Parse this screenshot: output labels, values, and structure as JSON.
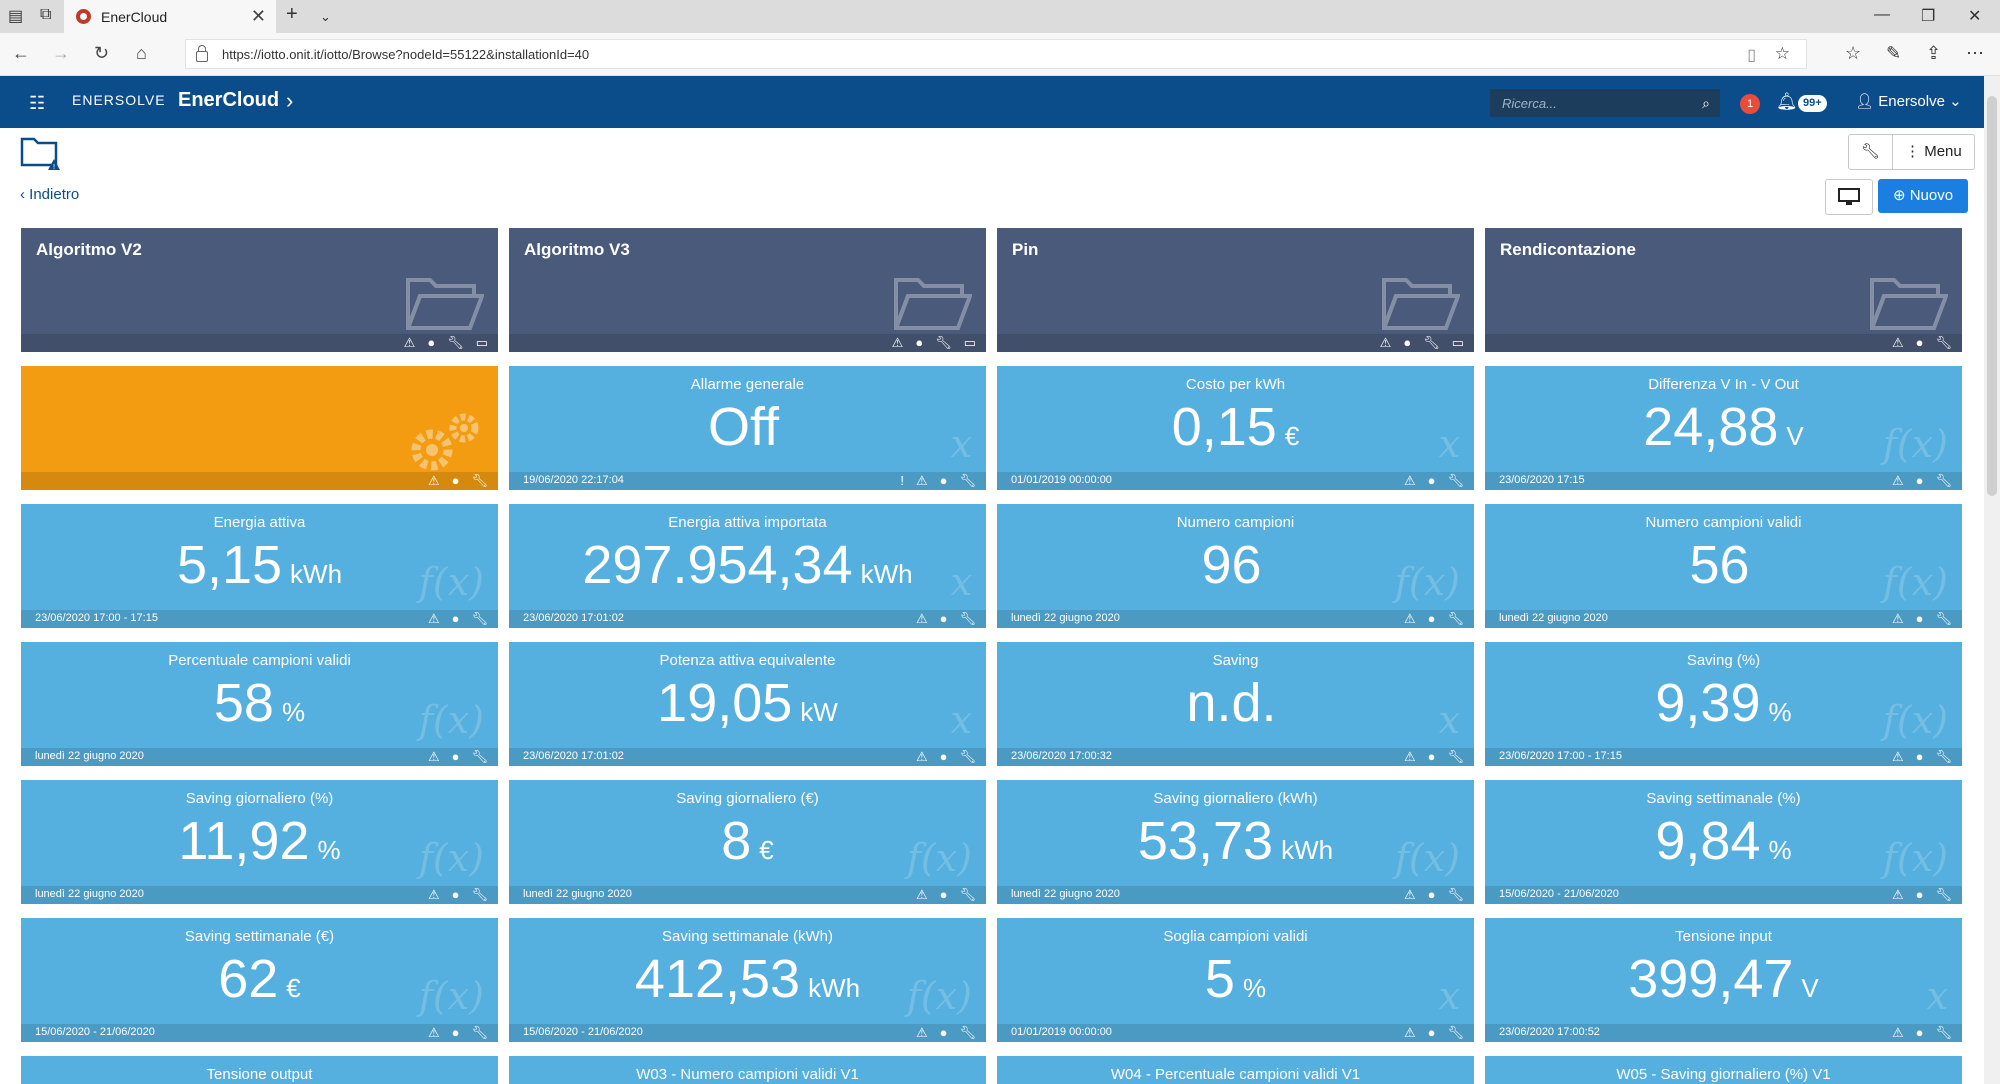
{
  "browser": {
    "tab_title": "EnerCloud",
    "url": "https://iotto.onit.it/iotto/Browse?nodeId=55122&installationId=40"
  },
  "header": {
    "logo": "ENERSOLVE",
    "brand": "EnerCloud",
    "search_placeholder": "Ricerca...",
    "alert_count": "1",
    "notif_count": "99+",
    "user": "Enersolve"
  },
  "sub": {
    "back_label": "Indietro",
    "menu_label": "Menu",
    "new_label": "Nuovo"
  },
  "folders": [
    {
      "title": "Algoritmo V2"
    },
    {
      "title": "Algoritmo V3"
    },
    {
      "title": "Pin"
    },
    {
      "title": "Rendicontazione"
    }
  ],
  "tiles": [
    {
      "title": "Allarme generale",
      "value": "Off",
      "unit": "",
      "date": "19/06/2020 22:17:04",
      "fx": "x"
    },
    {
      "title": "Costo per kWh",
      "value": "0,15",
      "unit": "€",
      "date": "01/01/2019 00:00:00",
      "fx": "x"
    },
    {
      "title": "Differenza V In - V Out",
      "value": "24,88",
      "unit": "V",
      "date": "23/06/2020 17:15",
      "fx": "f(x)"
    },
    {
      "title": "Energia attiva",
      "value": "5,15",
      "unit": "kWh",
      "date": "23/06/2020 17:00 - 17:15",
      "fx": "f(x)"
    },
    {
      "title": "Energia attiva importata",
      "value": "297.954,34",
      "unit": "kWh",
      "date": "23/06/2020 17:01:02",
      "fx": "x"
    },
    {
      "title": "Numero campioni",
      "value": "96",
      "unit": "",
      "date": "lunedì 22 giugno 2020",
      "fx": "f(x)"
    },
    {
      "title": "Numero campioni validi",
      "value": "56",
      "unit": "",
      "date": "lunedì 22 giugno 2020",
      "fx": "f(x)"
    },
    {
      "title": "Percentuale campioni validi",
      "value": "58",
      "unit": "%",
      "date": "lunedì 22 giugno 2020",
      "fx": "f(x)"
    },
    {
      "title": "Potenza attiva equivalente",
      "value": "19,05",
      "unit": "kW",
      "date": "23/06/2020 17:01:02",
      "fx": "x"
    },
    {
      "title": "Saving",
      "value": "n.d.",
      "unit": "",
      "date": "23/06/2020 17:00:32",
      "fx": "x"
    },
    {
      "title": "Saving (%)",
      "value": "9,39",
      "unit": "%",
      "date": "23/06/2020 17:00 - 17:15",
      "fx": "f(x)"
    },
    {
      "title": "Saving giornaliero (%)",
      "value": "11,92",
      "unit": "%",
      "date": "lunedì 22 giugno 2020",
      "fx": "f(x)"
    },
    {
      "title": "Saving giornaliero (€)",
      "value": "8",
      "unit": "€",
      "date": "lunedì 22 giugno 2020",
      "fx": "f(x)"
    },
    {
      "title": "Saving giornaliero (kWh)",
      "value": "53,73",
      "unit": "kWh",
      "date": "lunedì 22 giugno 2020",
      "fx": "f(x)"
    },
    {
      "title": "Saving settimanale (%)",
      "value": "9,84",
      "unit": "%",
      "date": "15/06/2020 - 21/06/2020",
      "fx": "f(x)"
    },
    {
      "title": "Saving settimanale (€)",
      "value": "62",
      "unit": "€",
      "date": "15/06/2020 - 21/06/2020",
      "fx": "f(x)"
    },
    {
      "title": "Saving settimanale (kWh)",
      "value": "412,53",
      "unit": "kWh",
      "date": "15/06/2020 - 21/06/2020",
      "fx": "f(x)"
    },
    {
      "title": "Soglia campioni validi",
      "value": "5",
      "unit": "%",
      "date": "01/01/2019 00:00:00",
      "fx": "x"
    },
    {
      "title": "Tensione input",
      "value": "399,47",
      "unit": "V",
      "date": "23/06/2020 17:00:52",
      "fx": "x"
    }
  ],
  "partial_tiles": [
    {
      "title": "Tensione output"
    },
    {
      "title": "W03 - Numero campioni validi V1"
    },
    {
      "title": "W04 - Percentuale campioni validi V1"
    },
    {
      "title": "W05 - Saving giornaliero (%) V1"
    }
  ]
}
